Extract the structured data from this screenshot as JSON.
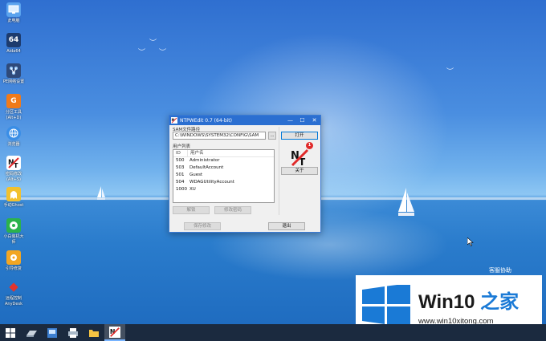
{
  "desktop": {
    "icons": [
      {
        "name": "this-pc",
        "label": "此电脑"
      },
      {
        "name": "aida64",
        "label": "Aida64",
        "glyph": "64",
        "color": "#1d3b6e"
      },
      {
        "name": "pe-network",
        "label": "PE网络设置",
        "color": "#2f4a7a"
      },
      {
        "name": "partition-tool",
        "label": "分区工具\n(Alt+D)",
        "glyph": "G",
        "color": "#f07a1a"
      },
      {
        "name": "browser",
        "label": "浏览器",
        "color": "#3a8ee6"
      },
      {
        "name": "ntpwedit",
        "label": "密码修改\n(Alt+S)",
        "color": "#ffffff"
      },
      {
        "name": "ghost",
        "label": "手动Ghost",
        "color": "#f2c12e"
      },
      {
        "name": "xiaobai",
        "label": "小白装机大\n师",
        "color": "#2bb24c"
      },
      {
        "name": "boot-repair",
        "label": "引导修复",
        "color": "#f2a623"
      },
      {
        "name": "anydesk",
        "label": "远程控制\nAnyDesk",
        "color": "#e2342c"
      }
    ]
  },
  "window": {
    "title": "NTPWEdit 0.7 (64-bit)",
    "sam_path_label": "SAM文件路径",
    "sam_path_value": "C:\\WINDOWS\\SYSTEM32\\CONFIG\\SAM",
    "browse_label": "...",
    "open_button": "打开",
    "user_list_label": "用户列表",
    "columns": [
      "ID",
      "用户名"
    ],
    "users": [
      {
        "id": "500",
        "name": "Administrator"
      },
      {
        "id": "503",
        "name": "DefaultAccount"
      },
      {
        "id": "501",
        "name": "Guest"
      },
      {
        "id": "504",
        "name": "WDAGUtilityAccount"
      },
      {
        "id": "1000",
        "name": "XU"
      }
    ],
    "unlock_button": "解锁",
    "change_password_button": "修改密码",
    "about_button": "关于",
    "save_button": "保存修改",
    "exit_button": "退出",
    "badge": "1",
    "minimize": "—",
    "maximize": "☐",
    "close": "✕"
  },
  "watermark": {
    "remote_assist": "客服协助",
    "brand_prefix": "Win10 ",
    "brand_suffix": "之家",
    "url": "www.win10xitong.com"
  },
  "taskbar": {
    "items": [
      "start-button",
      "drive-button",
      "computer-manager-button",
      "printer-button",
      "file-explorer-button",
      "ntpwedit-task-button"
    ]
  },
  "colors": {
    "titlebar": "#2b6fd1",
    "taskbar": "#1b2a3f",
    "windows_logo": "#1a7ad6"
  }
}
